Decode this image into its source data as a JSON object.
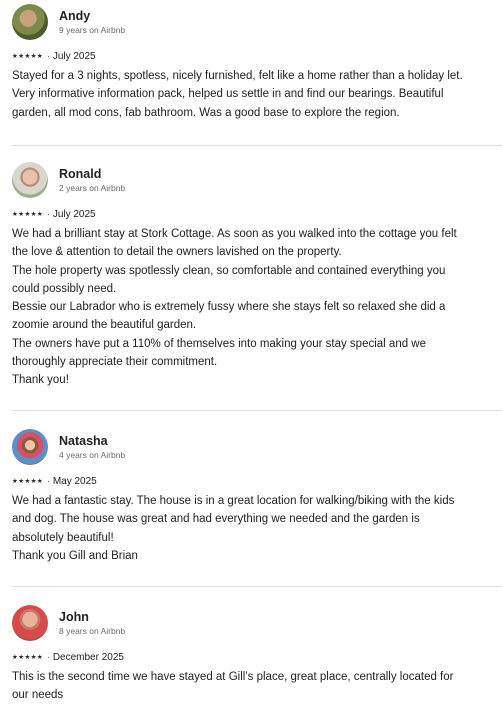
{
  "reviews": [
    {
      "name": "Andy",
      "tenure": "9 years on Airbnb",
      "stars": "★★★★★",
      "separator": "·",
      "date": "July 2025",
      "text": "Stayed for a 3 nights,  spotless, nicely furnished,  felt like a home rather than a holiday let.\nVery informative information pack, helped us settle in and find our bearings. Beautiful\ngarden, all mod cons, fab bathroom. Was a good base to explore the region."
    },
    {
      "name": "Ronald",
      "tenure": "2 years on Airbnb",
      "stars": "★★★★★",
      "separator": "·",
      "date": "July 2025",
      "text": "We had a brilliant stay at Stork Cottage. As soon as you walked into the cottage you felt\nthe love & attention to detail the owners lavished on the property.\nThe hole property was spotlessly clean, so comfortable and contained everything you\ncould possibly need.\nBessie our Labrador who is extremely fussy where she stays felt so relaxed she did a\nzoomie around the beautiful garden.\nThe owners have put a 110% of themselves into making your stay special and  we\nthoroughly appreciate their commitment.\nThank you!"
    },
    {
      "name": "Natasha",
      "tenure": "4 years on Airbnb",
      "stars": "★★★★★",
      "separator": "·",
      "date": "May 2025",
      "text": "We had a fantastic stay. The house is in a great location for walking/biking with the kids\nand dog. The house was great and had everything we needed and the garden is\nabsolutely beautiful!\nThank you Gill and Brian"
    },
    {
      "name": "John",
      "tenure": "8 years on Airbnb",
      "stars": "★★★★★",
      "separator": "·",
      "date": "December 2025",
      "text": "This is the second time we have stayed at Gill’s place, great place, centrally located for\nour needs"
    }
  ]
}
